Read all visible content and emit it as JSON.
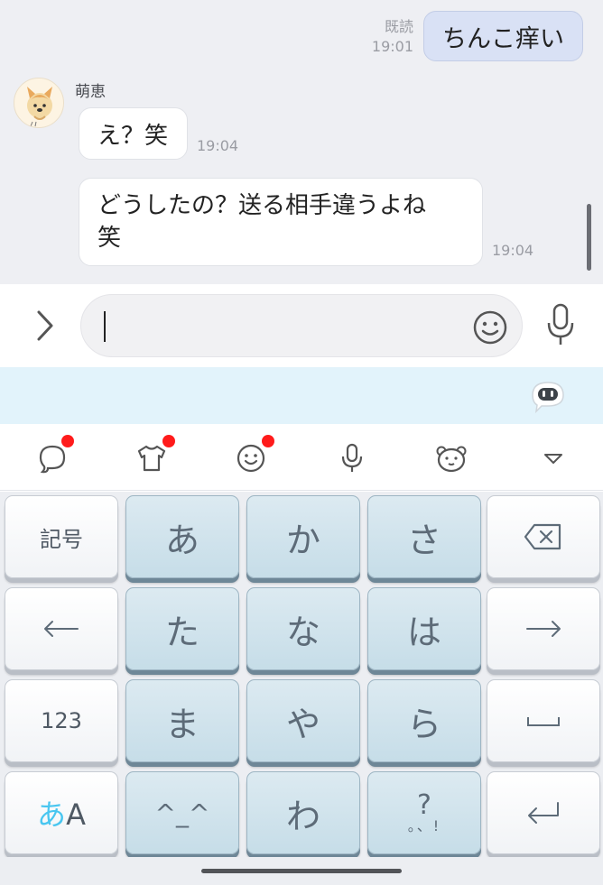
{
  "chat": {
    "sent": {
      "text": "ちんこ痒い",
      "read": "既読",
      "time": "19:01"
    },
    "received": {
      "sender": "萌恵",
      "messages": [
        {
          "text": "え？笑",
          "time": "19:04"
        },
        {
          "line1": "どうしたの？送る相手違うよね",
          "line2": "笑",
          "time": "19:04"
        }
      ]
    }
  },
  "input": {
    "value": "",
    "icons": [
      "chevron-right-icon",
      "smiley-icon",
      "mic-icon"
    ]
  },
  "keyboard": {
    "toolbar_icons": [
      "chat-bubble-icon",
      "tshirt-icon",
      "emoji-icon",
      "mic-icon",
      "bear-icon",
      "collapse-icon"
    ],
    "rows": [
      [
        "記号",
        "あ",
        "か",
        "さ",
        "backspace"
      ],
      [
        "←",
        "た",
        "な",
        "は",
        "→"
      ],
      [
        "123",
        "ま",
        "や",
        "ら",
        "space"
      ],
      [
        "あA",
        "^_^",
        "わ",
        "?。、!",
        "enter"
      ]
    ],
    "labels": {
      "kigou": "記号",
      "a": "あ",
      "ka": "か",
      "sa": "さ",
      "ta": "た",
      "na": "な",
      "ha": "は",
      "ma": "ま",
      "ya": "や",
      "ra": "ら",
      "num": "123",
      "hira": "あ",
      "alpha": "A",
      "kaomoji": "^_^",
      "wa": "わ",
      "punct_top": "?",
      "punct_bottom": "。、!"
    }
  },
  "colors": {
    "chat_bg": "#eeeff3",
    "sent_bubble": "#d9e1f5",
    "strip_bg": "#e2f3fb",
    "kana_key": "#c6dde8",
    "notification_dot": "#ff1b1b",
    "hira_accent": "#49c6f0"
  }
}
